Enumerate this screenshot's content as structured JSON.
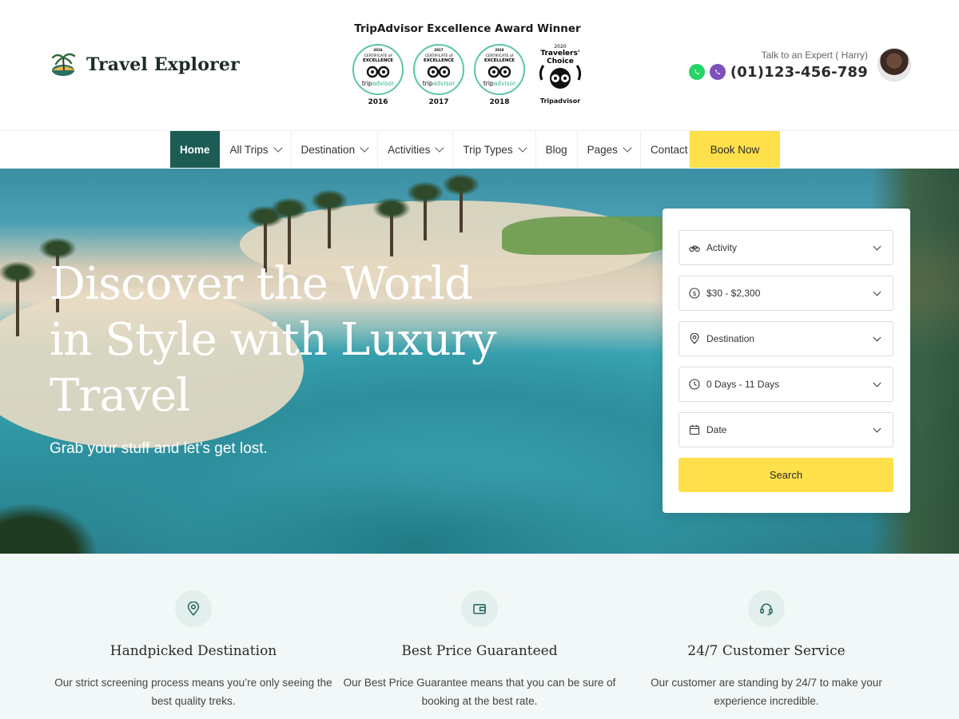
{
  "header": {
    "brand": "Travel Explorer",
    "award_title": "TripAdvisor Excellence Award Winner",
    "badges": [
      {
        "top": "CERTIFICATE of EXCELLENCE",
        "brand": "tripadvisor",
        "year": "2016"
      },
      {
        "top": "CERTIFICATE of EXCELLENCE",
        "brand": "tripadvisor",
        "year": "2017"
      },
      {
        "top": "CERTIFICATE of EXCELLENCE",
        "brand": "tripadvisor",
        "year": "2018"
      },
      {
        "top": "2020",
        "title": "Travelers' Choice",
        "brand": "Tripadvisor"
      }
    ],
    "expert_label": "Talk to an Expert ( Harry)",
    "phone": "(01)123-456-789"
  },
  "nav": {
    "items": [
      {
        "label": "Home",
        "dropdown": false,
        "active": true
      },
      {
        "label": "All Trips",
        "dropdown": true
      },
      {
        "label": "Destination",
        "dropdown": true
      },
      {
        "label": "Activities",
        "dropdown": true
      },
      {
        "label": "Trip Types",
        "dropdown": true
      },
      {
        "label": "Blog",
        "dropdown": false
      },
      {
        "label": "Pages",
        "dropdown": true
      },
      {
        "label": "Contact",
        "dropdown": false
      }
    ],
    "cta": "Book Now"
  },
  "hero": {
    "title": "Discover the World in Style with Luxury Travel",
    "subtitle": "Grab your stuff and let’s get lost."
  },
  "search": {
    "fields": [
      {
        "icon": "bicycle-icon",
        "value": "Activity"
      },
      {
        "icon": "dollar-icon",
        "value": "$30 - $2,300"
      },
      {
        "icon": "location-pin-icon",
        "value": "Destination"
      },
      {
        "icon": "clock-icon",
        "value": "0 Days - 11 Days"
      },
      {
        "icon": "calendar-icon",
        "value": "Date"
      }
    ],
    "button": "Search"
  },
  "features": [
    {
      "icon": "location-pin-icon",
      "title": "Handpicked Destination",
      "desc": "Our strict screening process means you’re only seeing the best quality treks."
    },
    {
      "icon": "wallet-icon",
      "title": "Best Price Guaranteed",
      "desc": "Our Best Price Guarantee means that you can be sure of booking at the best rate."
    },
    {
      "icon": "headset-icon",
      "title": "24/7 Customer Service",
      "desc": "Our customer are standing by 24/7 to make your experience incredible."
    }
  ],
  "colors": {
    "primary": "#1d5c55",
    "accent": "#fde04a",
    "feature_bg": "#f2f8f7",
    "whatsapp": "#25d366",
    "viber": "#7d4fbd"
  }
}
